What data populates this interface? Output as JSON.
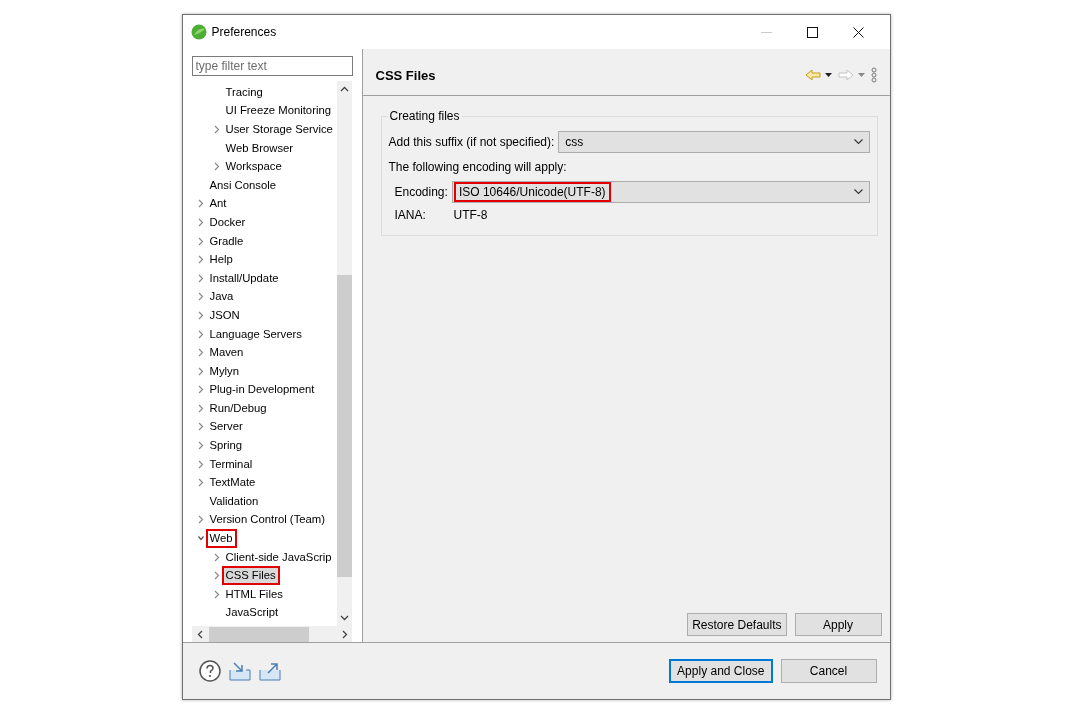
{
  "window": {
    "title": "Preferences"
  },
  "filter": {
    "placeholder": "type filter text"
  },
  "tree": {
    "scrolled_children": [
      {
        "label": "Tracing",
        "selected": false,
        "highlighted": false
      },
      {
        "label": "UI Freeze Monitoring",
        "selected": false,
        "highlighted": false
      },
      {
        "label": "User Storage Service",
        "expanded": false,
        "selected": false,
        "highlighted": false
      },
      {
        "label": "Web Browser",
        "selected": false,
        "highlighted": false
      },
      {
        "label": "Workspace",
        "expanded": false,
        "selected": false,
        "highlighted": false
      }
    ],
    "items": [
      {
        "label": "Ansi Console",
        "selected": false,
        "highlighted": false
      },
      {
        "label": "Ant",
        "expanded": false,
        "selected": false,
        "highlighted": false
      },
      {
        "label": "Docker",
        "expanded": false,
        "selected": false,
        "highlighted": false
      },
      {
        "label": "Gradle",
        "expanded": false,
        "selected": false,
        "highlighted": false
      },
      {
        "label": "Help",
        "expanded": false,
        "selected": false,
        "highlighted": false
      },
      {
        "label": "Install/Update",
        "expanded": false,
        "selected": false,
        "highlighted": false
      },
      {
        "label": "Java",
        "expanded": false,
        "selected": false,
        "highlighted": false
      },
      {
        "label": "JSON",
        "expanded": false,
        "selected": false,
        "highlighted": false
      },
      {
        "label": "Language Servers",
        "expanded": false,
        "selected": false,
        "highlighted": false
      },
      {
        "label": "Maven",
        "expanded": false,
        "selected": false,
        "highlighted": false
      },
      {
        "label": "Mylyn",
        "expanded": false,
        "selected": false,
        "highlighted": false
      },
      {
        "label": "Plug-in Development",
        "expanded": false,
        "selected": false,
        "highlighted": false
      },
      {
        "label": "Run/Debug",
        "expanded": false,
        "selected": false,
        "highlighted": false
      },
      {
        "label": "Server",
        "expanded": false,
        "selected": false,
        "highlighted": false
      },
      {
        "label": "Spring",
        "expanded": false,
        "selected": false,
        "highlighted": false
      },
      {
        "label": "Terminal",
        "expanded": false,
        "selected": false,
        "highlighted": false
      },
      {
        "label": "TextMate",
        "expanded": false,
        "selected": false,
        "highlighted": false
      },
      {
        "label": "Validation",
        "selected": false,
        "highlighted": false
      },
      {
        "label": "Version Control (Team)",
        "expanded": false,
        "selected": false,
        "highlighted": false
      },
      {
        "label": "Web",
        "expanded": true,
        "selected": false,
        "highlighted": true,
        "children": [
          {
            "label": "Client-side JavaScrip",
            "expanded": false,
            "selected": false,
            "highlighted": false
          },
          {
            "label": "CSS Files",
            "expanded": false,
            "selected": true,
            "highlighted": true
          },
          {
            "label": "HTML Files",
            "expanded": false,
            "selected": false,
            "highlighted": false
          },
          {
            "label": "JavaScript",
            "selected": false,
            "highlighted": false
          }
        ]
      }
    ]
  },
  "page": {
    "title": "CSS Files",
    "group": {
      "title": "Creating files",
      "suffix": {
        "label": "Add this suffix (if not specified):",
        "value": "css"
      },
      "note": "The following encoding will apply:",
      "encoding": {
        "label": "Encoding:",
        "value": "ISO 10646/Unicode(UTF-8)",
        "highlighted": true
      },
      "iana": {
        "label": "IANA:",
        "value": "UTF-8"
      }
    },
    "buttons": [
      "Restore Defaults",
      "Apply"
    ]
  },
  "footer": {
    "buttons": [
      {
        "label": "Apply and Close",
        "default": true
      },
      {
        "label": "Cancel",
        "default": false
      }
    ]
  }
}
